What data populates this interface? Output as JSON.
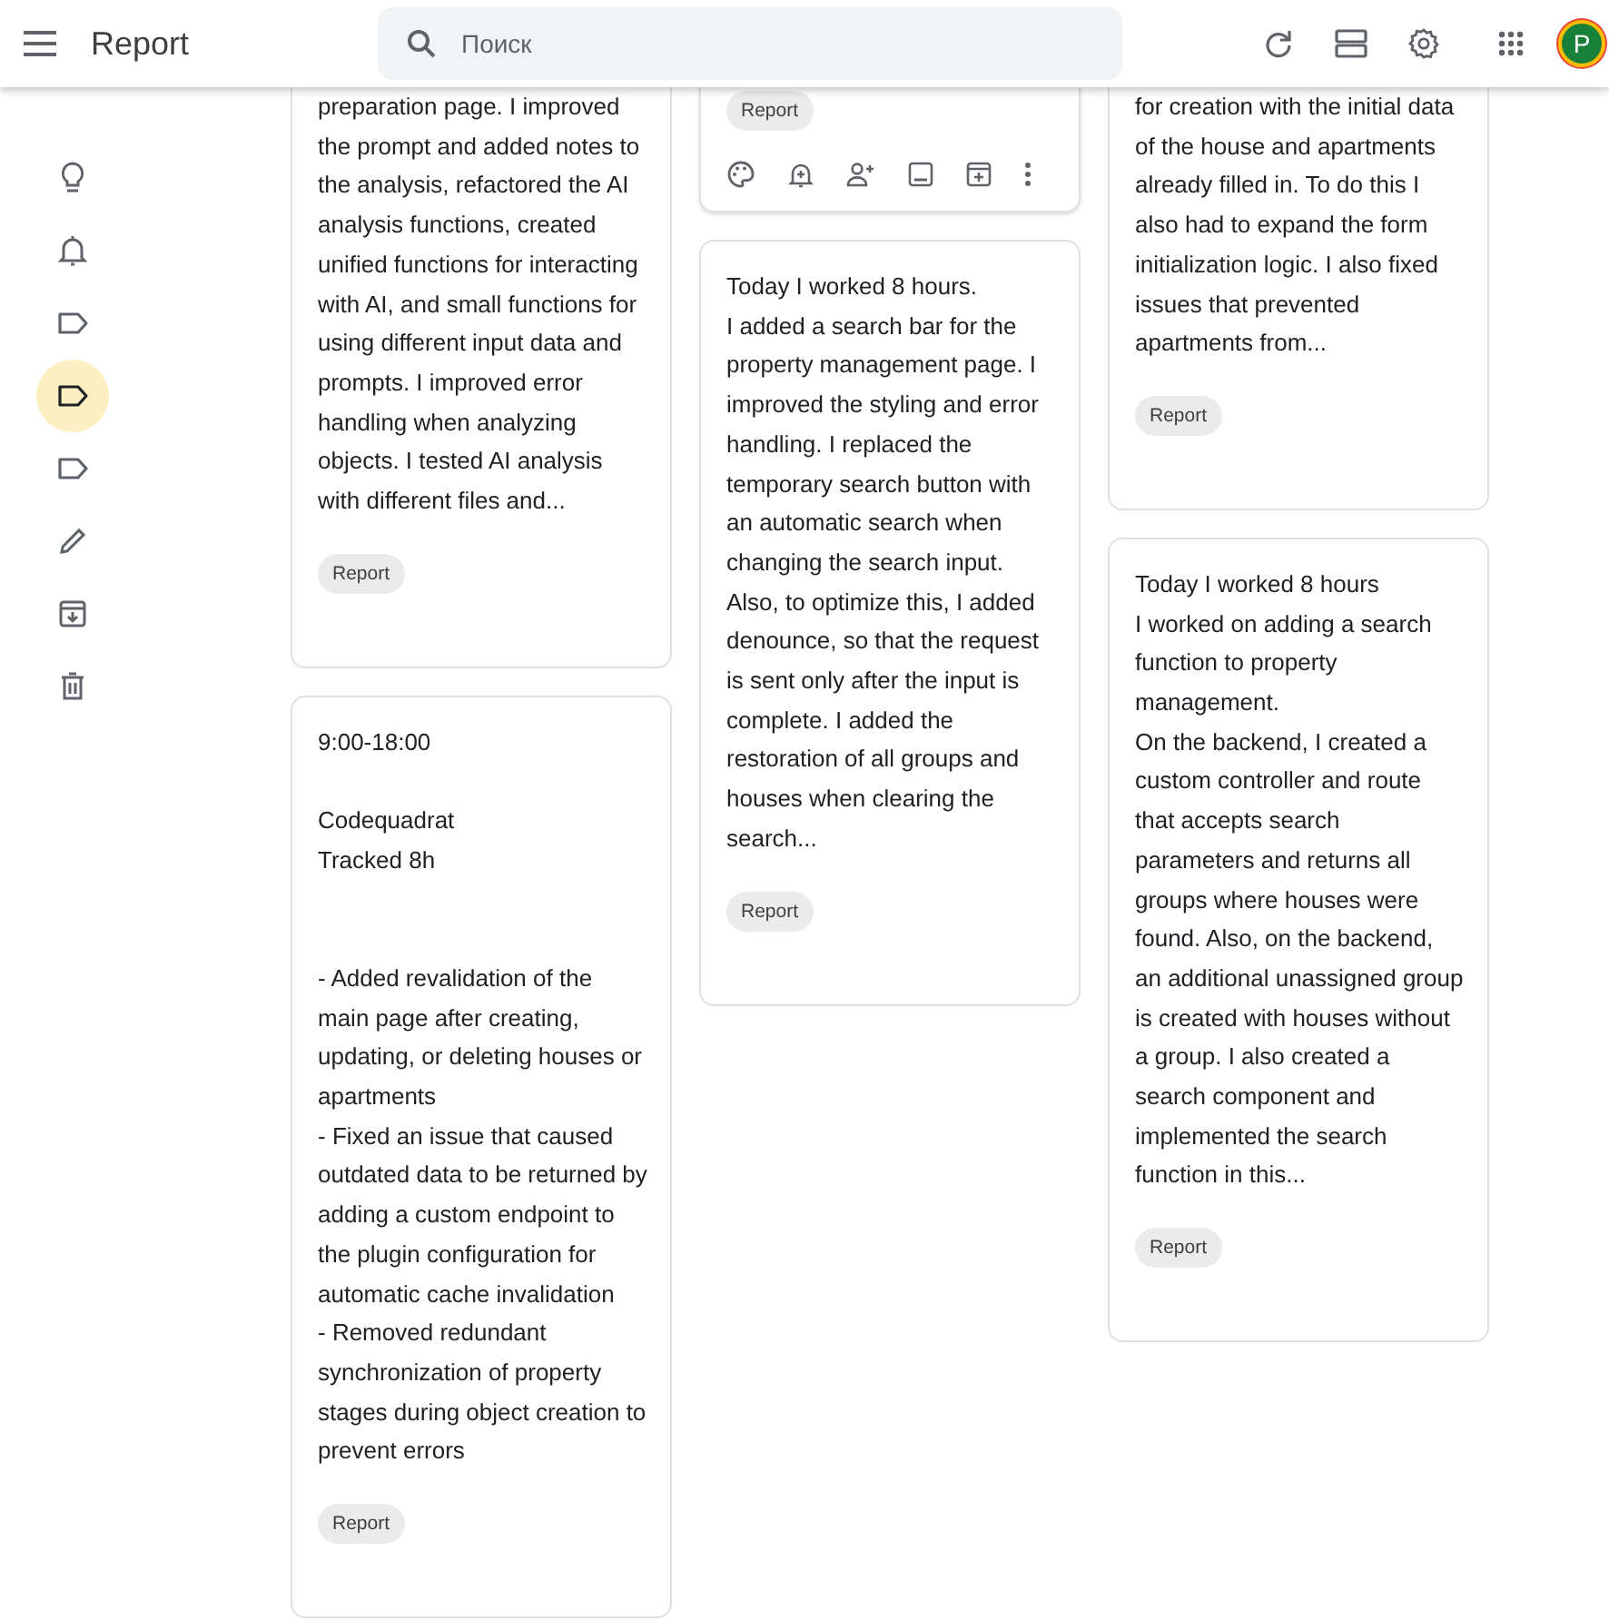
{
  "header": {
    "title": "Report",
    "search": {
      "placeholder": "Поиск"
    },
    "avatar": "P"
  },
  "sidebar": {
    "items": [
      {
        "kind": "bulb",
        "selected": false
      },
      {
        "kind": "bell",
        "selected": false
      },
      {
        "kind": "label",
        "selected": false
      },
      {
        "kind": "label",
        "selected": true
      },
      {
        "kind": "label",
        "selected": false
      },
      {
        "kind": "pencil",
        "selected": false
      },
      {
        "kind": "archive",
        "selected": false
      },
      {
        "kind": "trash",
        "selected": false
      }
    ]
  },
  "columns": [
    [
      {
        "text": "preparation page. I improved the prompt and added notes to the analysis, refactored the AI analysis functions, created unified functions for interacting with AI, and small functions for using different input data and prompts. I improved error handling when analyzing objects. I tested AI analysis with different files and...",
        "labels": [
          "Report"
        ],
        "toolbar": false
      },
      {
        "text": "9:00-18:00\n\nCodequadrat\nTracked 8h\n\n\n- Added revalidation of the main page after creating, updating, or deleting houses or apartments\n- Fixed an issue that caused outdated data to be returned by adding a custom endpoint to the plugin configuration for automatic cache invalidation\n- Removed redundant synchronization of property stages during object creation to prevent errors",
        "labels": [
          "Report"
        ],
        "toolbar": false
      }
    ],
    [
      {
        "labels": [
          "Report"
        ],
        "toolbar": true
      },
      {
        "text": "Today I worked 8 hours.\nI added a search bar for the property management page. I improved the styling and error handling. I replaced the temporary search button with an automatic search when changing the search input. Also, to optimize this, I added denounce, so that the request is sent only after the input is complete. I added the restoration of all groups and houses when clearing the search...",
        "labels": [
          "Report"
        ],
        "toolbar": false
      }
    ],
    [
      {
        "text": "for creation with the initial data of the house and apartments already filled in. To do this I also had to expand the form initialization logic. I also fixed issues that prevented apartments from...",
        "labels": [
          "Report"
        ],
        "toolbar": false
      },
      {
        "text": "Today I worked 8 hours\nI worked on adding a search function to property management.\nOn the backend, I created a custom controller and route that accepts search parameters and returns all groups where houses were found. Also, on the backend, an additional unassigned group is created with houses without a group. I also created a search component and implemented the search function in this...",
        "labels": [
          "Report"
        ],
        "toolbar": false
      }
    ]
  ]
}
